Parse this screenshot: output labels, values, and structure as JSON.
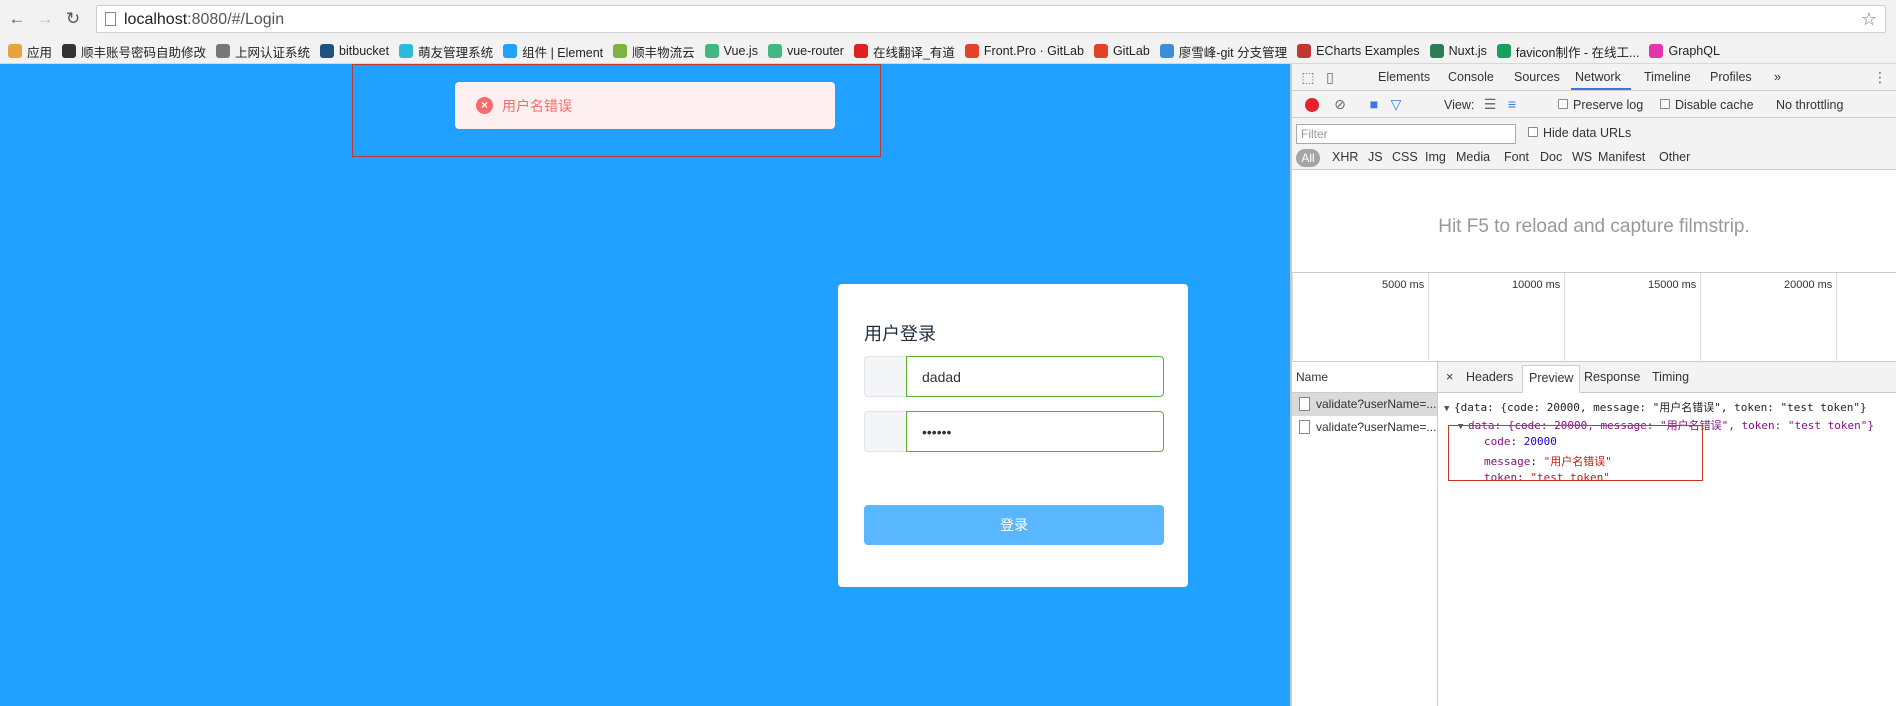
{
  "browser": {
    "url_host": "localhost",
    "url_rest": ":8080/#/Login",
    "bookmarks": [
      {
        "label": "应用",
        "icon": "apps-grid-icon",
        "color": "#e8a33c"
      },
      {
        "label": "顺丰账号密码自助修改",
        "icon": "sf-icon",
        "color": "#333333"
      },
      {
        "label": "上网认证系统",
        "icon": "page-icon",
        "color": "#777777"
      },
      {
        "label": "bitbucket",
        "icon": "bitbucket-icon",
        "color": "#205081"
      },
      {
        "label": "萌友管理系统",
        "icon": "mengyou-icon",
        "color": "#2bbbd8"
      },
      {
        "label": "组件 | Element",
        "icon": "element-icon",
        "color": "#20a0ff"
      },
      {
        "label": "顺丰物流云",
        "icon": "sf-cloud-icon",
        "color": "#7cb342"
      },
      {
        "label": "Vue.js",
        "icon": "vue-icon",
        "color": "#41b883"
      },
      {
        "label": "vue-router",
        "icon": "vue-icon",
        "color": "#41b883"
      },
      {
        "label": "在线翻译_有道",
        "icon": "youdao-icon",
        "color": "#e02020"
      },
      {
        "label": "Front.Pro · GitLab",
        "icon": "gitlab-icon",
        "color": "#e24329"
      },
      {
        "label": "GitLab",
        "icon": "gitlab-icon",
        "color": "#e24329"
      },
      {
        "label": "廖雪峰-git 分支管理",
        "icon": "rocket-icon",
        "color": "#3b8fd6"
      },
      {
        "label": "ECharts Examples",
        "icon": "echarts-icon",
        "color": "#c23531"
      },
      {
        "label": "Nuxt.js",
        "icon": "nuxt-icon",
        "color": "#2e7d57"
      },
      {
        "label": "favicon制作 - 在线工...",
        "icon": "favicon-icon",
        "color": "#17a05d"
      },
      {
        "label": "GraphQL",
        "icon": "graphql-icon",
        "color": "#e535ab"
      }
    ]
  },
  "page": {
    "alert_message": "用户名错误",
    "login": {
      "title": "用户登录",
      "username_value": "dadad",
      "password_value": "••••••",
      "button_label": "登录"
    }
  },
  "devtools": {
    "tabs": [
      "Elements",
      "Console",
      "Sources",
      "Network",
      "Timeline",
      "Profiles"
    ],
    "active_tab": "Network",
    "more_tabs": "»",
    "toolbar": {
      "view_label": "View:",
      "preserve_log": "Preserve log",
      "disable_cache": "Disable cache",
      "throttling": "No throttling"
    },
    "filter_placeholder": "Filter",
    "hide_data_urls": "Hide data URLs",
    "types": [
      "All",
      "XHR",
      "JS",
      "CSS",
      "Img",
      "Media",
      "Font",
      "Doc",
      "WS",
      "Manifest",
      "Other"
    ],
    "filmstrip_message": "Hit F5 to reload and capture filmstrip.",
    "timeline_ticks": [
      "5000 ms",
      "10000 ms",
      "15000 ms",
      "20000 ms"
    ],
    "name_header": "Name",
    "requests": [
      "validate?userName=...",
      "validate?userName=..."
    ],
    "detail_tabs": [
      "Headers",
      "Preview",
      "Response",
      "Timing"
    ],
    "detail_close": "×",
    "preview": {
      "line1_prefix": "{data: {code: 20000, message: \"用户名错误\", token: \"test token\"}",
      "line2_prefix": "data: {code: 20000, message: \"用户名错误\", token: \"test token\"}",
      "code_key": "code",
      "code_value": "20000",
      "message_key": "message",
      "message_value": "\"用户名错误\"",
      "token_key": "token",
      "token_value": "\"test token\""
    }
  }
}
